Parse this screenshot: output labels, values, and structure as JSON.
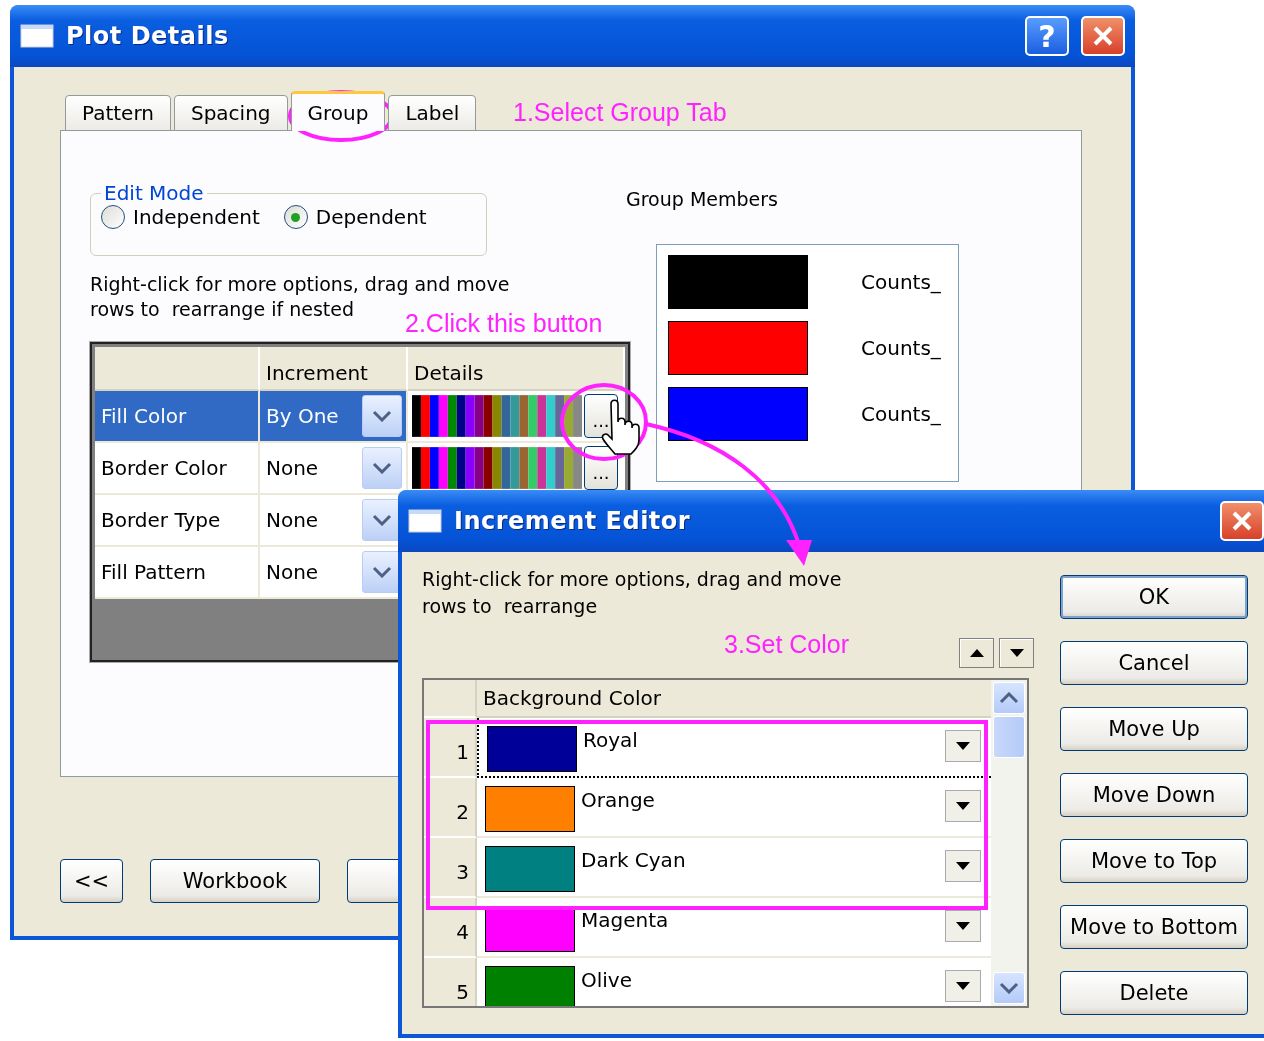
{
  "plot_details": {
    "title": "Plot Details",
    "help_button": "?",
    "tabs": [
      {
        "label": "Pattern",
        "selected": false
      },
      {
        "label": "Spacing",
        "selected": false
      },
      {
        "label": "Group",
        "selected": true
      },
      {
        "label": "Label",
        "selected": false
      }
    ],
    "tabs_note": "1.Select Group Tab",
    "edit_mode": {
      "label": "Edit Mode",
      "options": [
        {
          "label": "Independent",
          "selected": false
        },
        {
          "label": "Dependent",
          "selected": true
        }
      ]
    },
    "hint": "Right-click for more options, drag and move\nrows to  rearrange if nested",
    "grid_note": "2.Click this button",
    "grid": {
      "columns": [
        "Increment",
        "Details"
      ],
      "rows": [
        {
          "name": "Fill Color",
          "increment": "By One",
          "selected": true,
          "kind": "palette",
          "button": "..."
        },
        {
          "name": "Border Color",
          "increment": "None",
          "selected": false,
          "kind": "palette",
          "button": "..."
        },
        {
          "name": "Border Type",
          "increment": "None",
          "selected": false,
          "kind": "plain"
        },
        {
          "name": "Fill Pattern",
          "increment": "None",
          "selected": false,
          "kind": "plain"
        }
      ]
    },
    "group_members": {
      "label": "Group Members",
      "members": [
        {
          "name": "Counts_",
          "color": "#000000"
        },
        {
          "name": "Counts_",
          "color": "#ff0000"
        },
        {
          "name": "Counts_",
          "color": "#0000ff"
        }
      ]
    },
    "buttons": [
      "<<",
      "Workbook"
    ]
  },
  "increment_editor": {
    "title": "Increment Editor",
    "hint": "Right-click for more options, drag and move\nrows to  rearrange",
    "note": "3.Set Color",
    "grid": {
      "column": "Background Color",
      "rows": [
        {
          "index": "1",
          "color_name": "Royal",
          "color": "#000099",
          "selected": true
        },
        {
          "index": "2",
          "color_name": "Orange",
          "color": "#ff8000",
          "selected": false
        },
        {
          "index": "3",
          "color_name": "Dark Cyan",
          "color": "#008080",
          "selected": false
        },
        {
          "index": "4",
          "color_name": "Magenta",
          "color": "#ff00ff",
          "selected": false
        },
        {
          "index": "5",
          "color_name": "Olive",
          "color": "#008000",
          "selected": false
        }
      ]
    },
    "buttons": [
      "OK",
      "Cancel",
      "Move Up",
      "Move Down",
      "Move to Top",
      "Move to Bottom",
      "Delete"
    ]
  }
}
